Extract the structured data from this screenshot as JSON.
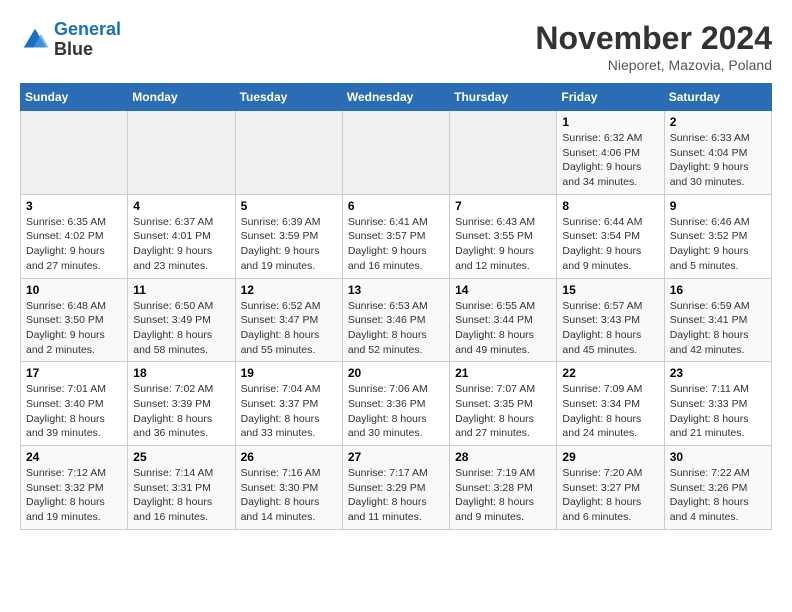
{
  "header": {
    "logo_line1": "General",
    "logo_line2": "Blue",
    "month": "November 2024",
    "location": "Nieporet, Mazovia, Poland"
  },
  "weekdays": [
    "Sunday",
    "Monday",
    "Tuesday",
    "Wednesday",
    "Thursday",
    "Friday",
    "Saturday"
  ],
  "weeks": [
    [
      {
        "day": "",
        "info": ""
      },
      {
        "day": "",
        "info": ""
      },
      {
        "day": "",
        "info": ""
      },
      {
        "day": "",
        "info": ""
      },
      {
        "day": "",
        "info": ""
      },
      {
        "day": "1",
        "info": "Sunrise: 6:32 AM\nSunset: 4:06 PM\nDaylight: 9 hours and 34 minutes."
      },
      {
        "day": "2",
        "info": "Sunrise: 6:33 AM\nSunset: 4:04 PM\nDaylight: 9 hours and 30 minutes."
      }
    ],
    [
      {
        "day": "3",
        "info": "Sunrise: 6:35 AM\nSunset: 4:02 PM\nDaylight: 9 hours and 27 minutes."
      },
      {
        "day": "4",
        "info": "Sunrise: 6:37 AM\nSunset: 4:01 PM\nDaylight: 9 hours and 23 minutes."
      },
      {
        "day": "5",
        "info": "Sunrise: 6:39 AM\nSunset: 3:59 PM\nDaylight: 9 hours and 19 minutes."
      },
      {
        "day": "6",
        "info": "Sunrise: 6:41 AM\nSunset: 3:57 PM\nDaylight: 9 hours and 16 minutes."
      },
      {
        "day": "7",
        "info": "Sunrise: 6:43 AM\nSunset: 3:55 PM\nDaylight: 9 hours and 12 minutes."
      },
      {
        "day": "8",
        "info": "Sunrise: 6:44 AM\nSunset: 3:54 PM\nDaylight: 9 hours and 9 minutes."
      },
      {
        "day": "9",
        "info": "Sunrise: 6:46 AM\nSunset: 3:52 PM\nDaylight: 9 hours and 5 minutes."
      }
    ],
    [
      {
        "day": "10",
        "info": "Sunrise: 6:48 AM\nSunset: 3:50 PM\nDaylight: 9 hours and 2 minutes."
      },
      {
        "day": "11",
        "info": "Sunrise: 6:50 AM\nSunset: 3:49 PM\nDaylight: 8 hours and 58 minutes."
      },
      {
        "day": "12",
        "info": "Sunrise: 6:52 AM\nSunset: 3:47 PM\nDaylight: 8 hours and 55 minutes."
      },
      {
        "day": "13",
        "info": "Sunrise: 6:53 AM\nSunset: 3:46 PM\nDaylight: 8 hours and 52 minutes."
      },
      {
        "day": "14",
        "info": "Sunrise: 6:55 AM\nSunset: 3:44 PM\nDaylight: 8 hours and 49 minutes."
      },
      {
        "day": "15",
        "info": "Sunrise: 6:57 AM\nSunset: 3:43 PM\nDaylight: 8 hours and 45 minutes."
      },
      {
        "day": "16",
        "info": "Sunrise: 6:59 AM\nSunset: 3:41 PM\nDaylight: 8 hours and 42 minutes."
      }
    ],
    [
      {
        "day": "17",
        "info": "Sunrise: 7:01 AM\nSunset: 3:40 PM\nDaylight: 8 hours and 39 minutes."
      },
      {
        "day": "18",
        "info": "Sunrise: 7:02 AM\nSunset: 3:39 PM\nDaylight: 8 hours and 36 minutes."
      },
      {
        "day": "19",
        "info": "Sunrise: 7:04 AM\nSunset: 3:37 PM\nDaylight: 8 hours and 33 minutes."
      },
      {
        "day": "20",
        "info": "Sunrise: 7:06 AM\nSunset: 3:36 PM\nDaylight: 8 hours and 30 minutes."
      },
      {
        "day": "21",
        "info": "Sunrise: 7:07 AM\nSunset: 3:35 PM\nDaylight: 8 hours and 27 minutes."
      },
      {
        "day": "22",
        "info": "Sunrise: 7:09 AM\nSunset: 3:34 PM\nDaylight: 8 hours and 24 minutes."
      },
      {
        "day": "23",
        "info": "Sunrise: 7:11 AM\nSunset: 3:33 PM\nDaylight: 8 hours and 21 minutes."
      }
    ],
    [
      {
        "day": "24",
        "info": "Sunrise: 7:12 AM\nSunset: 3:32 PM\nDaylight: 8 hours and 19 minutes."
      },
      {
        "day": "25",
        "info": "Sunrise: 7:14 AM\nSunset: 3:31 PM\nDaylight: 8 hours and 16 minutes."
      },
      {
        "day": "26",
        "info": "Sunrise: 7:16 AM\nSunset: 3:30 PM\nDaylight: 8 hours and 14 minutes."
      },
      {
        "day": "27",
        "info": "Sunrise: 7:17 AM\nSunset: 3:29 PM\nDaylight: 8 hours and 11 minutes."
      },
      {
        "day": "28",
        "info": "Sunrise: 7:19 AM\nSunset: 3:28 PM\nDaylight: 8 hours and 9 minutes."
      },
      {
        "day": "29",
        "info": "Sunrise: 7:20 AM\nSunset: 3:27 PM\nDaylight: 8 hours and 6 minutes."
      },
      {
        "day": "30",
        "info": "Sunrise: 7:22 AM\nSunset: 3:26 PM\nDaylight: 8 hours and 4 minutes."
      }
    ]
  ]
}
